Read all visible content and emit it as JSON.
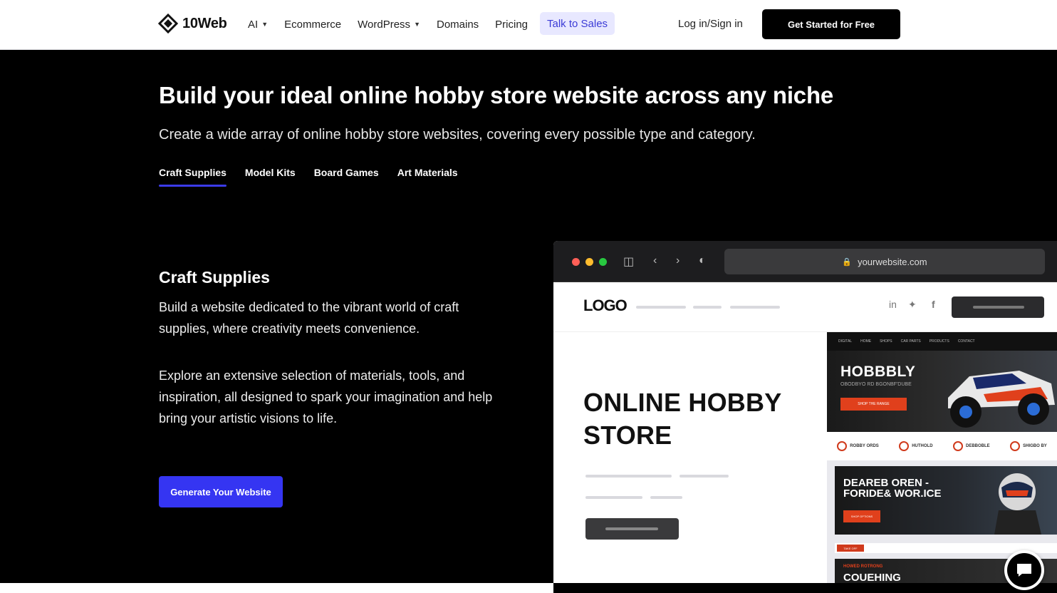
{
  "nav": {
    "logo_text": "10Web",
    "links": [
      {
        "label": "AI",
        "dropdown": true
      },
      {
        "label": "Ecommerce",
        "dropdown": false
      },
      {
        "label": "WordPress",
        "dropdown": true
      },
      {
        "label": "Domains",
        "dropdown": false
      },
      {
        "label": "Pricing",
        "dropdown": false
      }
    ],
    "talk_to_sales": "Talk to Sales",
    "login": "Log in/Sign in",
    "get_started": "Get Started for Free"
  },
  "hero": {
    "title": "Build your ideal online hobby store website across any niche",
    "subtitle": "Create a wide array of online hobby store websites, covering every possible type and category.",
    "tabs": [
      "Craft Supplies",
      "Model Kits",
      "Board Games",
      "Art Materials"
    ],
    "active_tab": "Craft Supplies"
  },
  "section": {
    "title": "Craft Supplies",
    "para1": "Build a website dedicated to the vibrant world of craft supplies, where creativity meets convenience.",
    "para2": "Explore an extensive selection of materials, tools, and inspiration, all designed to spark your imagination and help bring your artistic visions to life.",
    "button": "Generate Your Website"
  },
  "browser": {
    "url": "yourwebsite.com",
    "site_logo": "LOGO",
    "site_title_line1": "ONLINE HOBBY",
    "site_title_line2": "STORE",
    "social": [
      "in",
      "twitter",
      "f"
    ]
  },
  "preview": {
    "nav_items": [
      "DIGITAL",
      "HOME",
      "SHOPS",
      "CAR PARTS",
      "PRODUCTS",
      "CONTACT"
    ],
    "hero_title": "HOBBBLY",
    "hero_sub": "OBODBYO RD BGONBF'DUBE",
    "hero_btn": "SHOP THE RANGE",
    "features": [
      "ROBBY ORDS",
      "HUTHOLD",
      "DEBBOBLE",
      "SHIGBO BY"
    ],
    "card_title_line1": "DEAREB OREN -",
    "card_title_line2": "FORIDE& WOR.ICE",
    "card_btn": "SHOP OPTIONS",
    "strip_label": "TAKE OFF",
    "card2_small": "HOWED ROTRONG",
    "card2_big": "COUEHING"
  },
  "colors": {
    "accent": "#3535f2",
    "talk_bg": "#e8e8ff",
    "preview_red": "#e0401c"
  }
}
